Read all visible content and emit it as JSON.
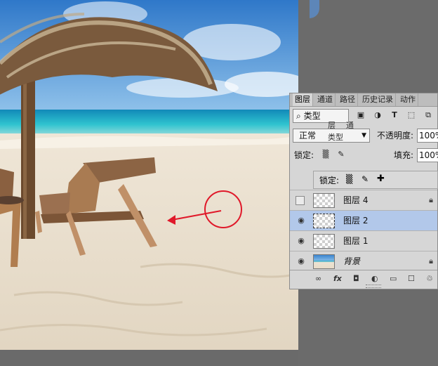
{
  "app": {
    "accent": "#b2c8ea"
  },
  "panel": {
    "tabs": [
      {
        "label": "图层"
      },
      {
        "label": "通道"
      },
      {
        "label": "路径"
      },
      {
        "label": "历史记录"
      },
      {
        "label": "动作"
      }
    ],
    "filter": {
      "type_label": "类型",
      "icons": [
        "image-filter-icon",
        "adjustment-filter-icon",
        "text-filter-icon",
        "shape-filter-icon",
        "smart-object-filter-icon"
      ]
    },
    "blend_mode": "正常",
    "opacity_label": "不透明度:",
    "opacity_value": "100%",
    "lock_label": "锁定:",
    "fill_label": "填充:",
    "fill_value": "100%",
    "ghost_tab_layers": "层",
    "ghost_tab_channels": "通",
    "ghost_type": "类型",
    "floating_lock_label": "锁定:",
    "layers": [
      {
        "name": "图层 4",
        "visible": false,
        "locked": true,
        "selected": false
      },
      {
        "name": "图层 2",
        "visible": true,
        "locked": false,
        "selected": true
      },
      {
        "name": "图层 1",
        "visible": true,
        "locked": false,
        "selected": false
      },
      {
        "name": "背景",
        "visible": true,
        "locked": true,
        "selected": false
      }
    ]
  }
}
